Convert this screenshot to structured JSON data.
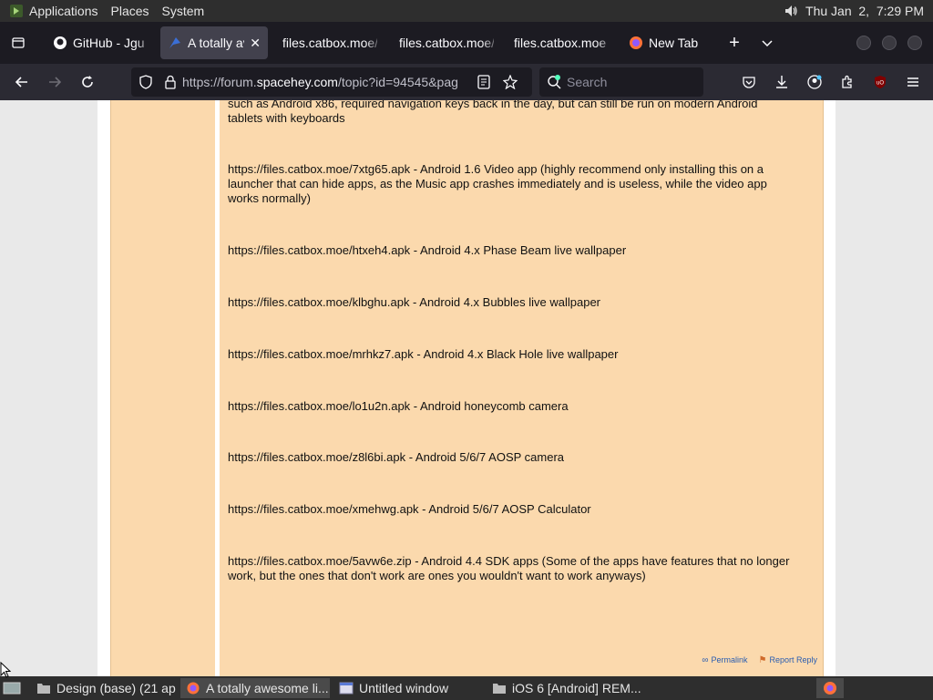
{
  "top_panel": {
    "menus": [
      "Applications",
      "Places",
      "System"
    ],
    "clock": "Thu Jan  2,  7:29 PM"
  },
  "tabs": [
    {
      "label": "GitHub - Jgu",
      "icon": "github-icon",
      "active": false
    },
    {
      "label": "A totally av",
      "icon": "spacehey-icon",
      "active": true
    },
    {
      "label": "files.catbox.moe/",
      "icon": "none",
      "active": false
    },
    {
      "label": "files.catbox.moe/",
      "icon": "none",
      "active": false
    },
    {
      "label": "files.catbox.moe",
      "icon": "none",
      "active": false
    },
    {
      "label": "New Tab",
      "icon": "firefox-icon",
      "active": false
    }
  ],
  "navbar": {
    "url_scheme": "https://forum.",
    "url_host": "spacehey.com",
    "url_rest": "/topic?id=94545&pag",
    "search_placeholder": "Search"
  },
  "post": {
    "lines": [
      "such as Android x86, required navigation keys back in the day, but can still be run on modern Android tablets with keyboards",
      "https://files.catbox.moe/7xtg65.apk - Android 1.6 Video app (highly recommend only installing this on a launcher that can hide apps, as the Music app crashes immediately and is useless, while the video app works normally)",
      "https://files.catbox.moe/htxeh4.apk - Android 4.x Phase Beam live wallpaper",
      "https://files.catbox.moe/klbghu.apk - Android 4.x Bubbles live wallpaper",
      "https://files.catbox.moe/mrhkz7.apk - Android 4.x Black Hole live wallpaper",
      "https://files.catbox.moe/lo1u2n.apk - Android honeycomb camera",
      "https://files.catbox.moe/z8l6bi.apk - Android 5/6/7 AOSP camera",
      "https://files.catbox.moe/xmehwg.apk - Android 5/6/7 AOSP Calculator",
      "https://files.catbox.moe/5avw6e.zip - Android 4.4 SDK apps (Some of the apps have features that no longer work, but the ones that don't work are ones you wouldn't want to work anyways)"
    ],
    "permalink": "Permalink",
    "report_reply": "Report Reply"
  },
  "taskbar": [
    {
      "label": "Design (base) (21 ap...",
      "icon": "folder-icon",
      "active": false
    },
    {
      "label": "A totally awesome li...",
      "icon": "firefox-icon",
      "active": true
    },
    {
      "label": "Untitled window",
      "icon": "window-icon",
      "active": false
    },
    {
      "label": "iOS 6 [Android] REM...",
      "icon": "folder-icon",
      "active": false
    }
  ],
  "colors": {
    "post_bg": "#fbd9ad",
    "link_blue": "#2a5db0",
    "chrome_dark": "#1c1b22"
  }
}
